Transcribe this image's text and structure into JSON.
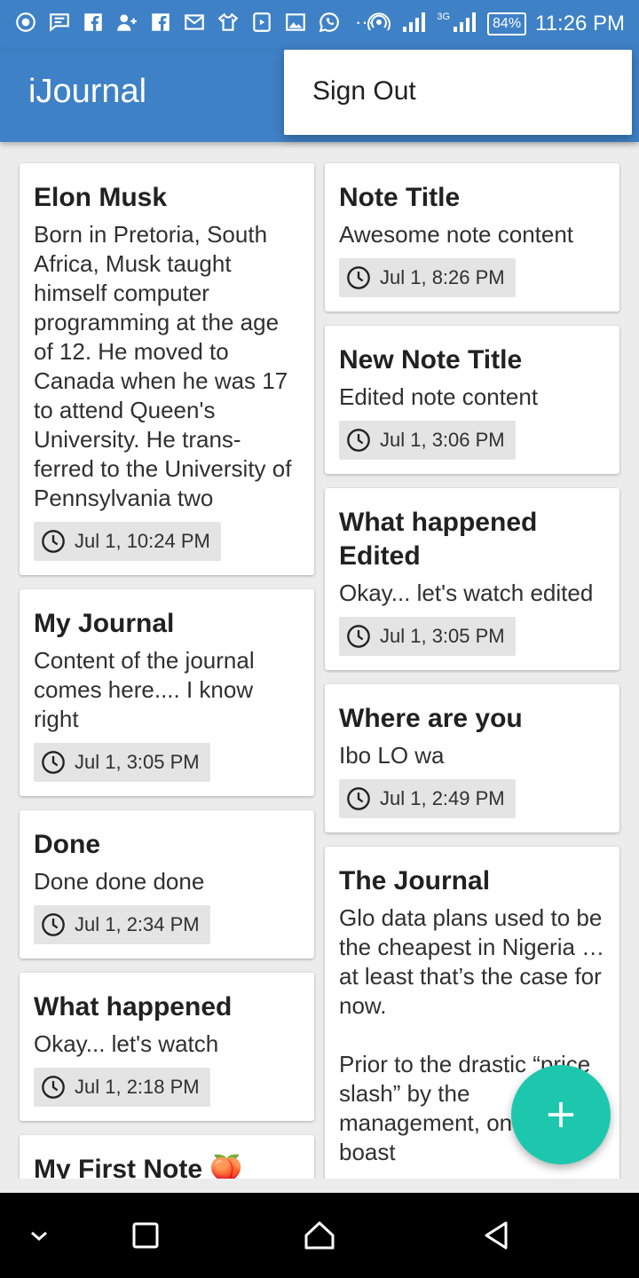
{
  "status_bar": {
    "time": "11:26 PM",
    "battery": "84%",
    "network_tag": "3G",
    "more": "···",
    "left_icons": [
      "browser-icon",
      "message-icon",
      "facebook-icon",
      "add-friend-icon",
      "facebook-icon",
      "gmail-icon",
      "shop-icon",
      "play-store-icon",
      "gallery-icon",
      "whatsapp-icon"
    ],
    "right_icons": [
      "hotspot-icon",
      "signal-icon",
      "signal-icon",
      "battery-icon"
    ]
  },
  "app_bar": {
    "title": "iJournal",
    "background": "#3f81c6"
  },
  "overflow_menu": {
    "items": [
      {
        "label": "Sign Out"
      }
    ]
  },
  "notes": {
    "left": [
      {
        "title": "Elon Musk",
        "content": "Born in Pretoria, South Africa, Musk taught himself computer programming at the age of 12. He moved to Canada when he was 17 to attend Queen's University. He trans-\nferred to the University of Pennsylvania two",
        "time": "Jul 1, 10:24 PM"
      },
      {
        "title": "My Journal",
        "content": "Content of the journal comes here.... I know right",
        "time": "Jul 1, 3:05 PM"
      },
      {
        "title": "Done",
        "content": "Done done done",
        "time": "Jul 1, 2:34 PM"
      },
      {
        "title": "What happened",
        "content": "Okay... let's watch",
        "time": "Jul 1, 2:18 PM"
      },
      {
        "title": "My First Note 🍑",
        "content": "",
        "time": ""
      }
    ],
    "right": [
      {
        "title": "Note Title",
        "content": "Awesome note content",
        "time": "Jul 1, 8:26 PM"
      },
      {
        "title": "New Note Title",
        "content": "Edited note content",
        "time": "Jul 1, 3:06 PM"
      },
      {
        "title": "What happened Edited",
        "content": "Okay... let's watch edited",
        "time": "Jul 1, 3:05 PM"
      },
      {
        "title": "Where are you",
        "content": "Ibo LO wa",
        "time": "Jul 1, 2:49 PM"
      },
      {
        "title": "The Journal",
        "content": "Glo data plans used to be the cheapest in Nigeria … at least that’s the case for now.\n\nPrior to the drastic “price slash” by the management, one could boast",
        "time": ""
      }
    ]
  },
  "fab": {
    "icon": "plus-icon",
    "color": "#1dc7ad"
  },
  "nav_bar": {
    "buttons": [
      "collapse-icon",
      "recent-apps-icon",
      "home-icon",
      "back-icon"
    ]
  }
}
